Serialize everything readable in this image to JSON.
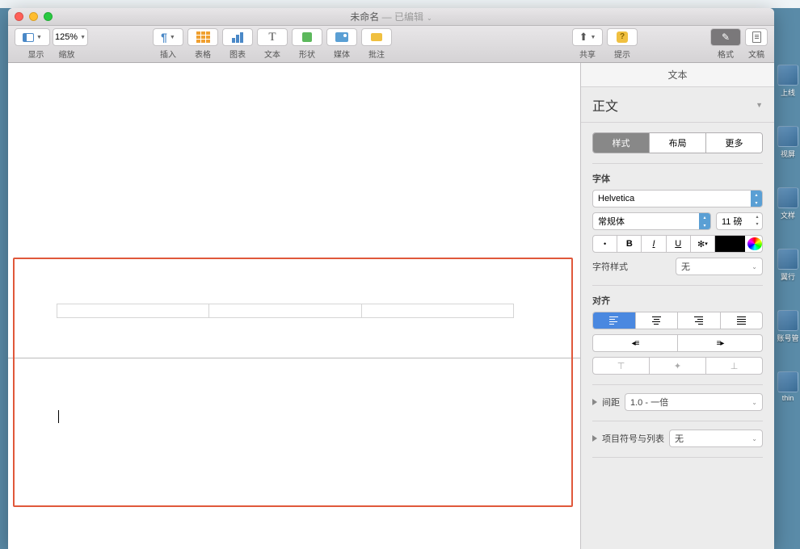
{
  "title": {
    "name": "未命名",
    "sep": " — ",
    "status": "已编辑"
  },
  "toolbar": {
    "view": "显示",
    "zoom_val": "125%",
    "zoom": "缩放",
    "insert": "插入",
    "table": "表格",
    "chart": "图表",
    "text": "文本",
    "shape": "形状",
    "media": "媒体",
    "comment": "批注",
    "share": "共享",
    "tip": "提示",
    "format": "格式",
    "doc": "文稿"
  },
  "sidebar": {
    "tab": "文本",
    "style_name": "正文",
    "seg": {
      "style": "样式",
      "layout": "布局",
      "more": "更多"
    },
    "font_h": "字体",
    "font_family": "Helvetica",
    "font_weight": "常规体",
    "font_size": "11 磅",
    "gear": "✽",
    "char_style_h": "字符样式",
    "char_style_v": "无",
    "align_h": "对齐",
    "spacing_h": "间距",
    "spacing_v": "1.0 - 一倍",
    "bullets_h": "项目符号与列表",
    "bullets_v": "无",
    "b": "B",
    "i": "I",
    "u": "U",
    "s": "U"
  },
  "desktop": [
    "上线",
    "视屏",
    "文样",
    "翼行",
    "账号管",
    "thin"
  ]
}
